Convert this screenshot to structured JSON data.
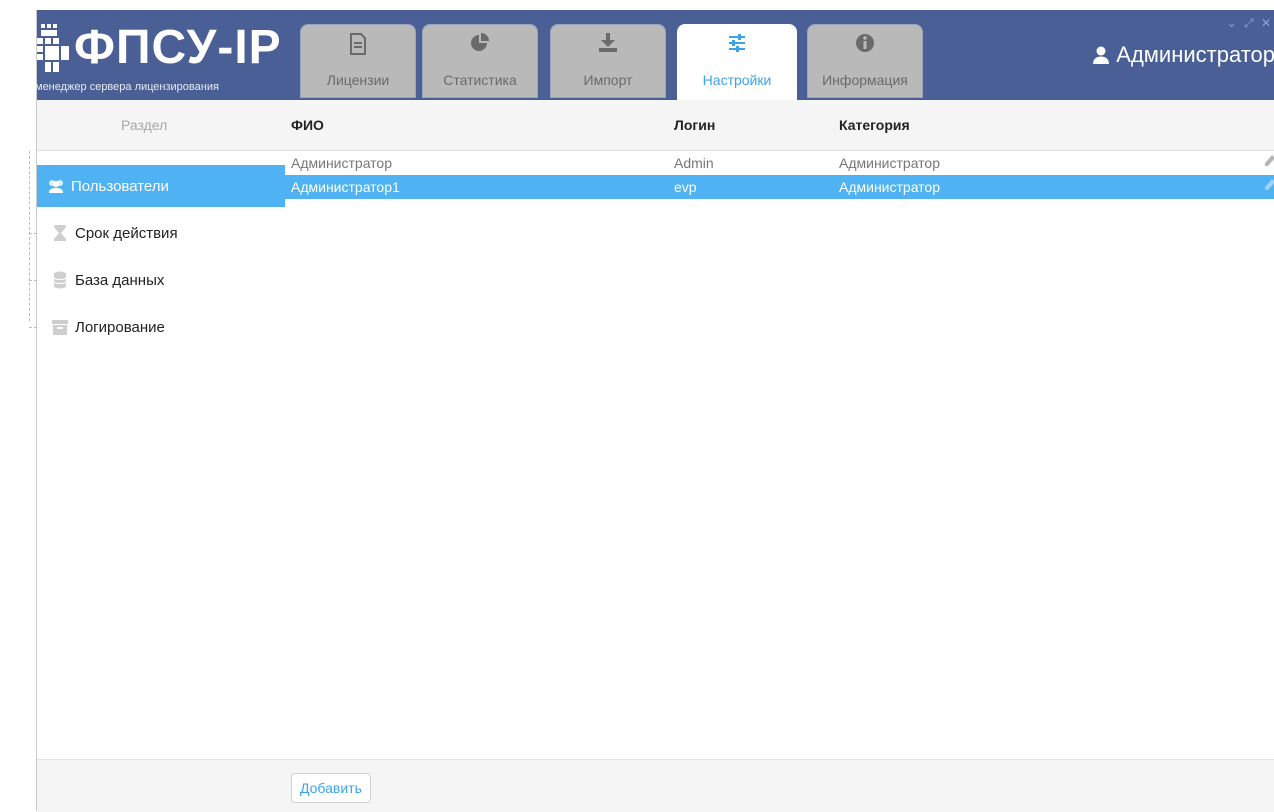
{
  "brand": {
    "title": "ФПСУ-IP",
    "subtitle": "менеджер сервера лицензирования",
    "accent": "#4fb2f3",
    "header_bg": "#4a5f95"
  },
  "tabs": [
    {
      "label": "Лицензии",
      "icon": "document-icon",
      "active": false
    },
    {
      "label": "Статистика",
      "icon": "pie-chart-icon",
      "active": false
    },
    {
      "label": "Импорт",
      "icon": "download-icon",
      "active": false
    },
    {
      "label": "Настройки",
      "icon": "sliders-icon",
      "active": true
    },
    {
      "label": "Информация",
      "icon": "info-icon",
      "active": false
    }
  ],
  "user": {
    "name": "Администратор",
    "icon": "user-icon"
  },
  "columns": {
    "section": "Раздел",
    "fio": "ФИО",
    "login": "Логин",
    "category": "Категория"
  },
  "sidebar": {
    "items": [
      {
        "label": "Пользователи",
        "icon": "users-icon",
        "active": true
      },
      {
        "label": "Срок действия",
        "icon": "hourglass-icon",
        "active": false
      },
      {
        "label": "База данных",
        "icon": "database-icon",
        "active": false
      },
      {
        "label": "Логирование",
        "icon": "archive-icon",
        "active": false
      }
    ]
  },
  "table": {
    "rows": [
      {
        "fio": "Администратор",
        "login": "Admin",
        "category": "Администратор",
        "selected": false
      },
      {
        "fio": "Администратор1",
        "login": "evp",
        "category": "Администратор",
        "selected": true
      }
    ]
  },
  "footer": {
    "add_label": "Добавить"
  }
}
